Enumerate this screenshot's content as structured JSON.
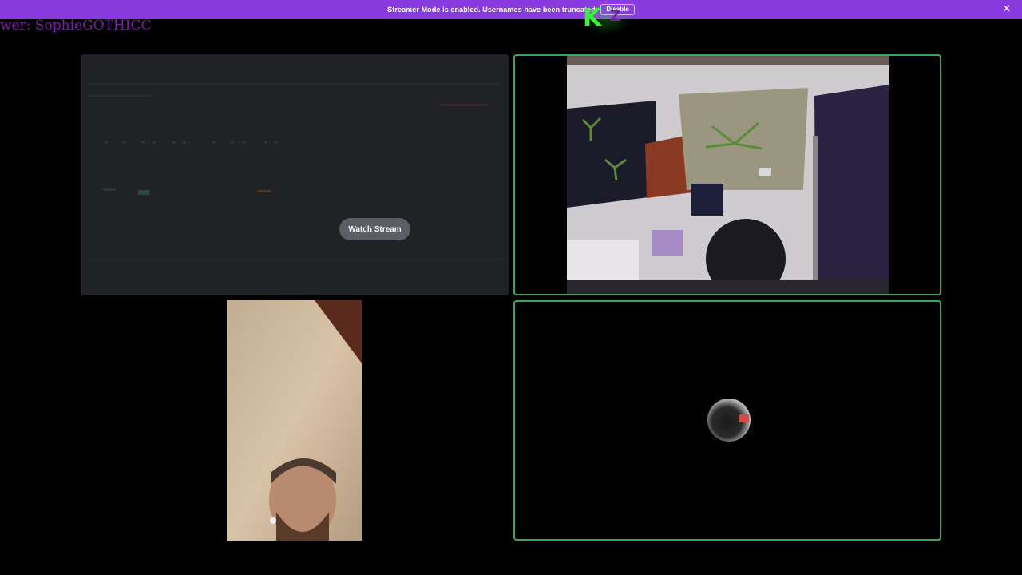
{
  "banner": {
    "message": "Streamer Mode is enabled. Usernames have been truncated.",
    "button_label": "Disable",
    "close_icon": "close-icon",
    "background_color": "#8a3be0"
  },
  "overlay": {
    "viewer_text": "wer: SophieGOTHICC",
    "logo_icon": "kz-logo-icon"
  },
  "stream_tile": {
    "watch_label": "Watch Stream"
  },
  "tiles": {
    "cam1_icon": "webcam-video",
    "cam2_icon": "webcam-video",
    "avatar_icon": "user-avatar"
  },
  "colors": {
    "speaking_border": "#3ba55c",
    "tile_background": "#1e1f22",
    "watch_button": "#5c5e66"
  }
}
